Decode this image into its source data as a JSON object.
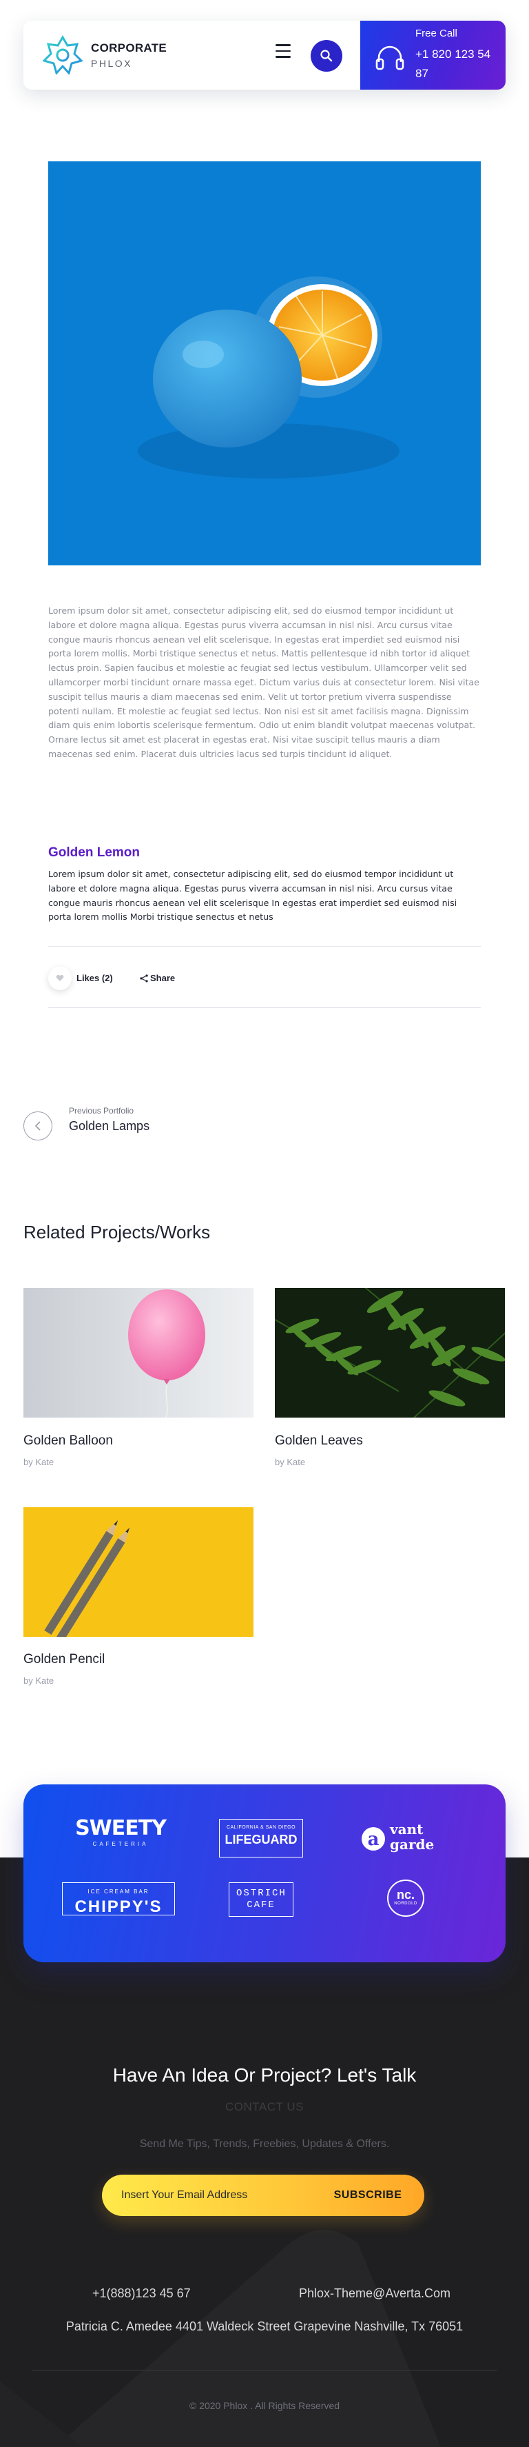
{
  "header": {
    "brand_title": "CORPORATE",
    "brand_subtitle": "PHLOX",
    "call_label": "Free Call",
    "call_number": "+1 820 123 54 87",
    "accent_color": "#2b24c9"
  },
  "content": {
    "intro_text": "Lorem ipsum dolor sit amet, consectetur adipiscing elit, sed do eiusmod tempor incididunt ut labore et dolore magna aliqua. Egestas purus viverra accumsan in nisl nisi. Arcu cursus vitae congue mauris rhoncus aenean vel elit scelerisque. In egestas erat imperdiet sed euismod nisi porta lorem mollis. Morbi tristique senectus et netus. Mattis pellentesque id nibh tortor id aliquet lectus proin. Sapien faucibus et molestie ac feugiat sed lectus vestibulum. Ullamcorper velit sed ullamcorper morbi tincidunt ornare massa eget. Dictum varius duis at consectetur lorem. Nisi vitae suscipit tellus mauris a diam maecenas sed enim. Velit ut tortor pretium viverra suspendisse potenti nullam. Et molestie ac feugiat sed lectus. Non nisi est sit amet facilisis magna. Dignissim diam quis enim lobortis scelerisque fermentum. Odio ut enim blandit volutpat maecenas volutpat. Ornare lectus sit amet est placerat in egestas erat. Nisi vitae suscipit tellus mauris a diam maecenas sed enim. Placerat duis ultricies lacus sed turpis tincidunt id aliquet.",
    "section_title": "Golden Lemon",
    "section_text": "Lorem ipsum dolor sit amet, consectetur adipiscing elit, sed do eiusmod tempor incididunt ut labore et dolore magna aliqua. Egestas purus viverra accumsan in nisl nisi. Arcu cursus vitae congue mauris rhoncus aenean vel elit scelerisque In egestas erat imperdiet sed euismod nisi porta lorem mollis Morbi tristique senectus et netus",
    "likes_label": "Likes (2)",
    "share_label": "Share",
    "title_color": "#5b1cc9"
  },
  "navigation": {
    "previous_caption": "Previous Portfolio",
    "previous_title": "Golden Lamps"
  },
  "related": {
    "heading": "Related Projects/Works",
    "cards": [
      {
        "title": "Golden Balloon",
        "author": "by Kate"
      },
      {
        "title": "Golden Leaves",
        "author": "by Kate"
      },
      {
        "title": "Golden Pencil",
        "author": "by Kate"
      }
    ]
  },
  "clients": {
    "logos": [
      {
        "name": "SWEETY",
        "sub": "CAFETERIA"
      },
      {
        "name": "LIFEGUARD",
        "sub": "CALIFORNIA & SAN DIEGO"
      },
      {
        "name": "vant garde",
        "sub": ""
      },
      {
        "name": "CHIPPY'S",
        "sub": "ICE CREAM BAR"
      },
      {
        "name": "OSTRICH CAFE",
        "sub": ""
      },
      {
        "name": "nc.",
        "sub": "NORDOLD"
      }
    ]
  },
  "footer": {
    "cta_title": "Have An Idea Or Project? Let's Talk",
    "cta_link": "CONTACT US",
    "newsletter_text": "Send Me Tips, Trends, Freebies, Updates & Offers.",
    "email_placeholder": "Insert Your Email Address",
    "subscribe_label": "SUBSCRIBE",
    "phone": "+1(888)123 45 67",
    "email": "Phlox-Theme@Averta.Com",
    "address": "Patricia C. Amedee 4401 Waldeck Street Grapevine Nashville, Tx 76051",
    "copyright": "© 2020 Phlox . All Rights Reserved"
  }
}
